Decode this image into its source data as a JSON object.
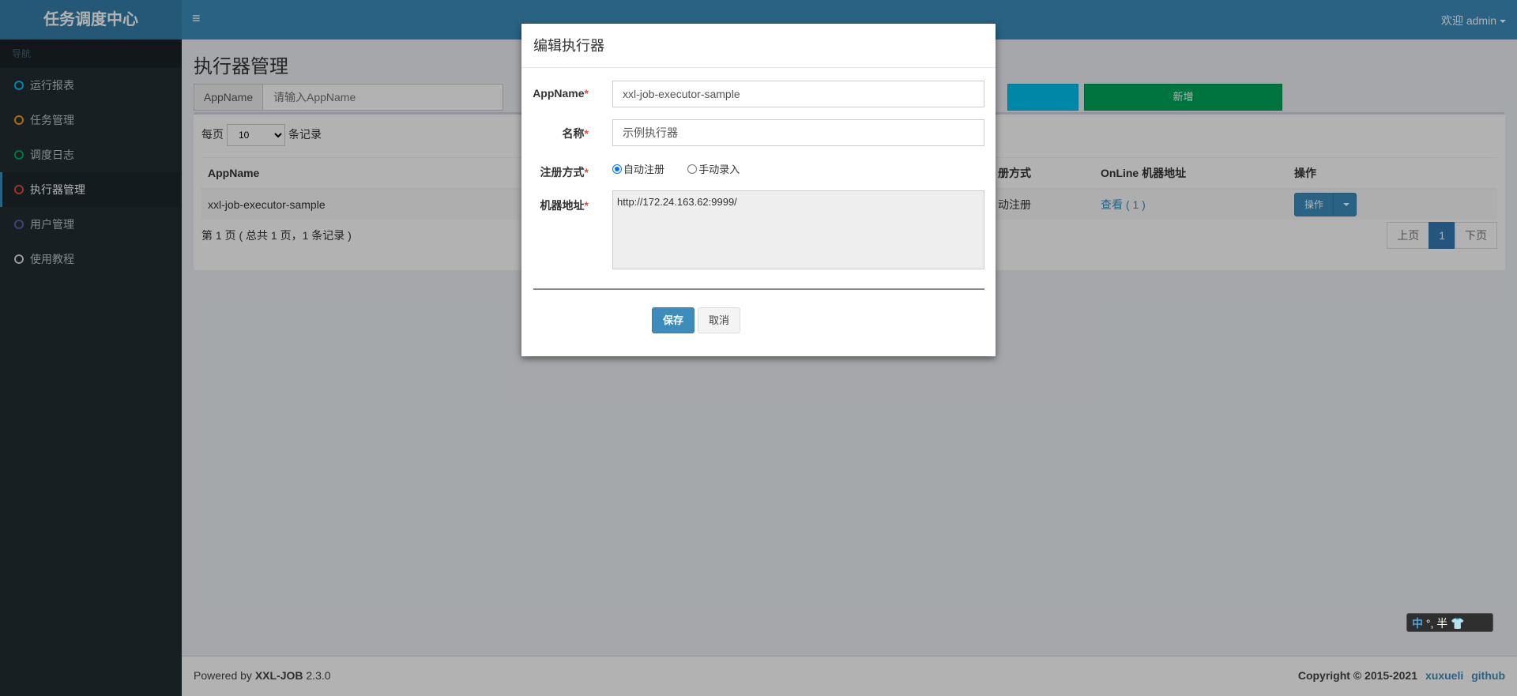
{
  "header": {
    "logo": "任务调度中心",
    "hamburger": "≡",
    "user_menu": "欢迎 admin"
  },
  "sidebar": {
    "nav_header": "导航",
    "items": [
      {
        "label": "运行报表",
        "color": "#00c0ef"
      },
      {
        "label": "任务管理",
        "color": "#f39c12"
      },
      {
        "label": "调度日志",
        "color": "#00a65a"
      },
      {
        "label": "执行器管理",
        "color": "#dd4b39"
      },
      {
        "label": "用户管理",
        "color": "#605ca8"
      },
      {
        "label": "使用教程",
        "color": "#d2d6de"
      }
    ]
  },
  "main": {
    "title": "执行器管理",
    "search_addon": "AppName",
    "search_placeholder": "请输入AppName",
    "add_button": "新增",
    "page_size_prefix": "每页",
    "page_size_value": "10",
    "page_size_suffix": "条记录",
    "table": {
      "headers": [
        "AppName",
        "册方式",
        "OnLine 机器地址",
        "操作"
      ],
      "row": {
        "appname": "xxl-job-executor-sample",
        "reg_type": "动注册",
        "online": "查看 ( 1 )",
        "op": "操作"
      }
    },
    "info": "第 1 页 ( 总共 1 页，1 条记录 )",
    "pager": {
      "prev": "上页",
      "current": "1",
      "next": "下页"
    }
  },
  "modal": {
    "title": "编辑执行器",
    "appname_label": "AppName",
    "appname_value": "xxl-job-executor-sample",
    "name_label": "名称",
    "name_value": "示例执行器",
    "reg_label": "注册方式",
    "reg_auto": "自动注册",
    "reg_manual": "手动录入",
    "addr_label": "机器地址",
    "addr_value": "http://172.24.163.62:9999/",
    "required_mark": "*",
    "save": "保存",
    "cancel": "取消"
  },
  "footer": {
    "powered_prefix": "Powered by ",
    "powered_name": "XXL-JOB",
    "version": " 2.3.0",
    "copyright": "Copyright © 2015-2021",
    "link1": "xuxueli",
    "link2": "github"
  },
  "ime": {
    "zh": "中",
    "rest": "°, 半 👕"
  }
}
